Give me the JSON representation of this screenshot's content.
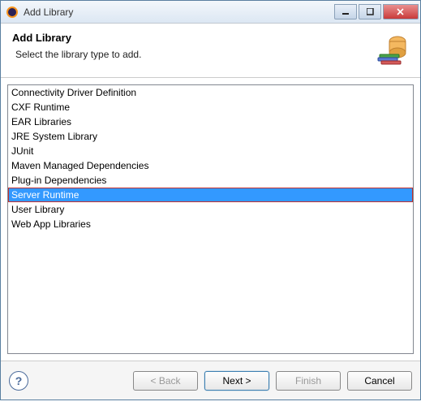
{
  "window": {
    "title": "Add Library"
  },
  "header": {
    "title": "Add Library",
    "description": "Select the library type to add."
  },
  "library_list": {
    "items": [
      "Connectivity Driver Definition",
      "CXF Runtime",
      "EAR Libraries",
      "JRE System Library",
      "JUnit",
      "Maven Managed Dependencies",
      "Plug-in Dependencies",
      "Server Runtime",
      "User Library",
      "Web App Libraries"
    ],
    "selected_index": 7
  },
  "buttons": {
    "help": "?",
    "back": "< Back",
    "next": "Next >",
    "finish": "Finish",
    "cancel": "Cancel"
  }
}
